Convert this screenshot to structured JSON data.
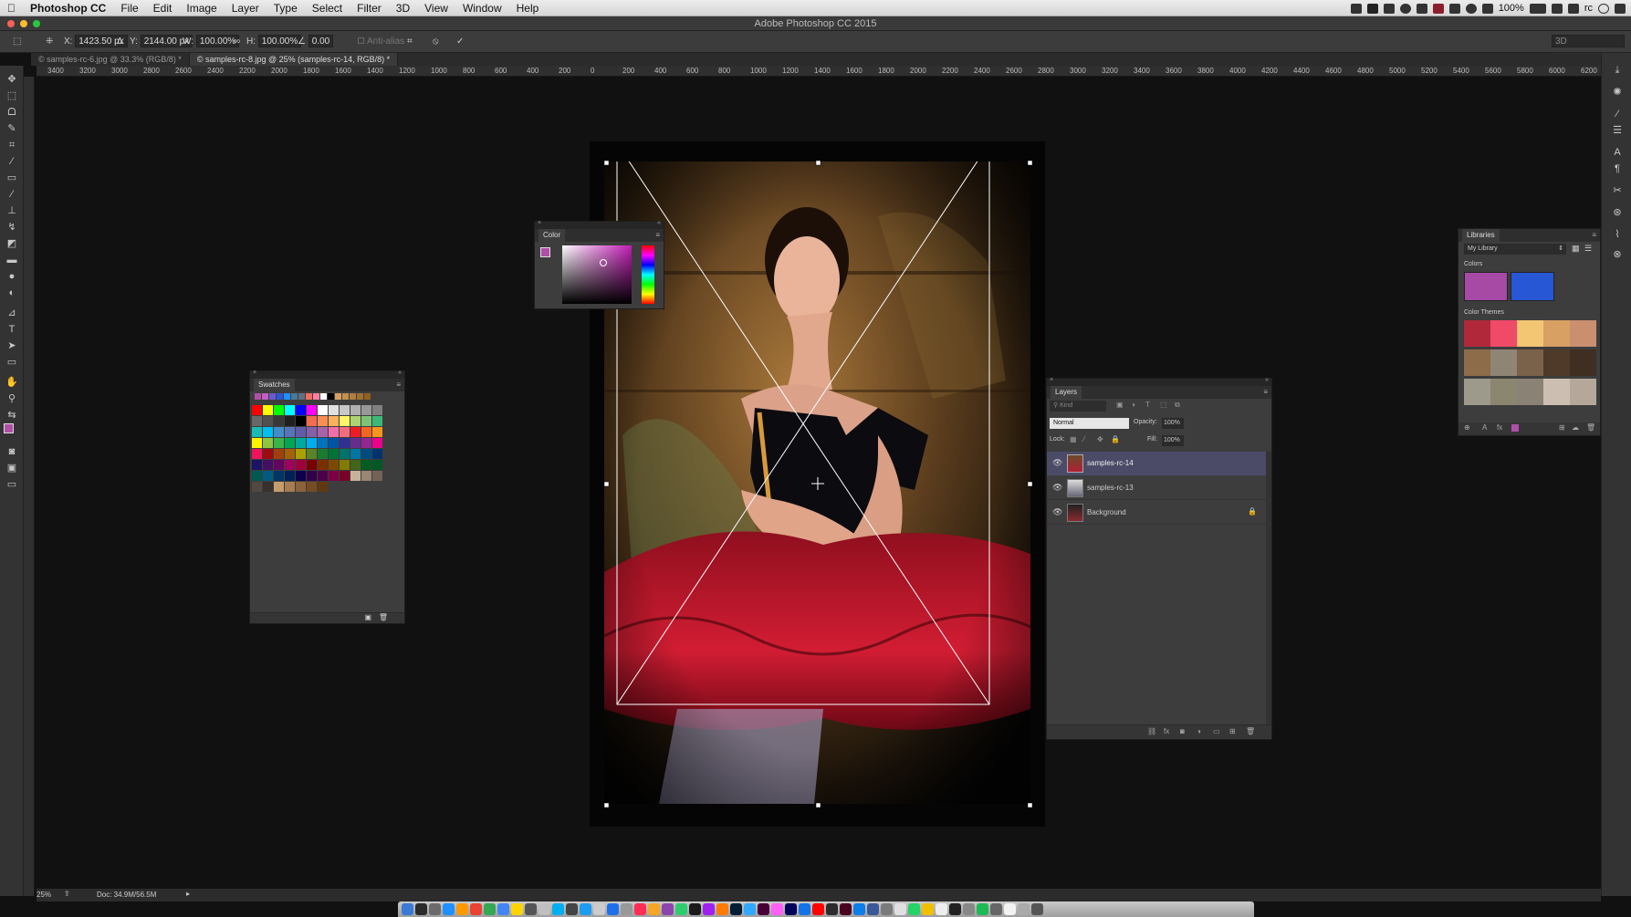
{
  "menubar": {
    "app_name": "Photoshop CC",
    "menus": [
      "File",
      "Edit",
      "Image",
      "Layer",
      "Type",
      "Select",
      "Filter",
      "3D",
      "View",
      "Window",
      "Help"
    ],
    "battery": "100%",
    "user": "rc"
  },
  "window": {
    "title": "Adobe Photoshop CC 2015"
  },
  "options_bar": {
    "x_label": "X:",
    "x_value": "1423.50 px",
    "y_label": "Y:",
    "y_value": "2144.00 px",
    "w_label": "W:",
    "w_value": "100.00%",
    "h_label": "H:",
    "h_value": "100.00%",
    "angle_label": "∠",
    "angle_value": "0.00",
    "antialias_label": "Anti-alias",
    "workspace_label": "3D"
  },
  "doc_tabs": [
    {
      "label": "© samples-rc-6.jpg @ 33.3% (RGB/8) *",
      "active": false
    },
    {
      "label": "© samples-rc-8.jpg @ 25% (samples-rc-14, RGB/8) *",
      "active": true
    }
  ],
  "ruler_ticks": [
    "3400",
    "3200",
    "3000",
    "2800",
    "2600",
    "2400",
    "2200",
    "2000",
    "1800",
    "1600",
    "1400",
    "1200",
    "1000",
    "800",
    "600",
    "400",
    "200",
    "0",
    "200",
    "400",
    "600",
    "800",
    "1000",
    "1200",
    "1400",
    "1600",
    "1800",
    "2000",
    "2200",
    "2400",
    "2600",
    "2800",
    "3000",
    "3200",
    "3400",
    "3600",
    "3800",
    "4000",
    "4200",
    "4400",
    "4600",
    "4800",
    "5000",
    "5200",
    "5400",
    "5600",
    "5800",
    "6000",
    "6200"
  ],
  "color_panel": {
    "title": "Color",
    "foreground": "#b04fa8",
    "background": "#ffffff"
  },
  "swatches_panel": {
    "title": "Swatches"
  },
  "layers_panel": {
    "title": "Layers",
    "filter_placeholder": "Kind",
    "blend_mode": "Normal",
    "opacity_label": "Opacity:",
    "opacity_value": "100%",
    "lock_label": "Lock:",
    "fill_label": "Fill:",
    "fill_value": "100%",
    "layers": [
      {
        "name": "samples-rc-14",
        "selected": true,
        "locked": false
      },
      {
        "name": "samples-rc-13",
        "selected": false,
        "locked": false
      },
      {
        "name": "Background",
        "selected": false,
        "locked": true
      }
    ]
  },
  "libraries_panel": {
    "title": "Libraries",
    "library_name": "My Library",
    "colors_label": "Colors",
    "colors": [
      "#a64aa6",
      "#2857d6"
    ],
    "themes_label": "Color Themes",
    "themes": [
      [
        "#b0283a",
        "#ef4a68",
        "#f3c673",
        "#d8a063",
        "#c98f6e"
      ],
      [
        "#8d6c4a",
        "#8f8575",
        "#7a614a",
        "#4f3a2a",
        "#3f2f22"
      ],
      [
        "#9d9a8c",
        "#8a8670",
        "#8a8275",
        "#ccbfb2",
        "#b5a89a"
      ]
    ]
  },
  "status_bar": {
    "zoom": "25%",
    "doc_info": "Doc: 34.9M/56.5M"
  }
}
